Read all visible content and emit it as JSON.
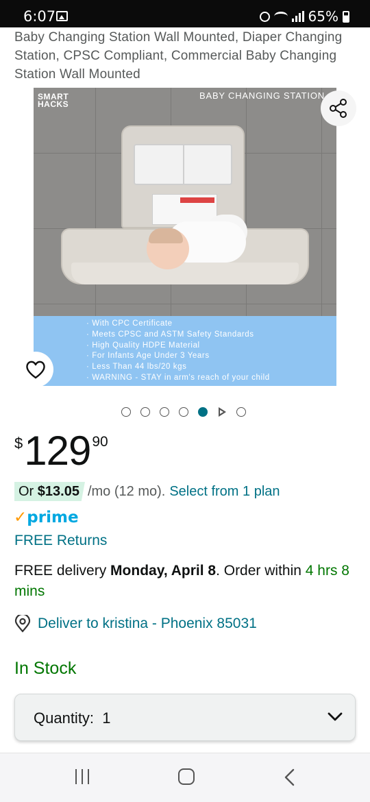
{
  "status_bar": {
    "time": "6:07",
    "battery": "65%",
    "icons": [
      "gallery-icon",
      "alarm-icon",
      "wifi-icon",
      "signal-icon",
      "battery-icon"
    ]
  },
  "product": {
    "title": "Baby Changing Station Wall Mounted, Diaper Changing Station, CPSC Compliant, Commercial Baby Changing Station Wall Mounted",
    "image": {
      "brand_logo": "SMART HACKS",
      "heading": "BABY CHANGING STATION",
      "features": [
        "With CPC Certificate",
        "Meets CPSC and ASTM Safety Standards",
        "High Quality HDPE Material",
        "For Infants Age Under 3 Years",
        "Less Than 44 lbs/20 kgs",
        "WARNING - STAY in arm's reach of your child"
      ],
      "panel_color": "#8fc4f2"
    },
    "gallery": {
      "total_items": 7,
      "active_index": 4,
      "video_index": 5
    }
  },
  "price": {
    "symbol": "$",
    "whole": "129",
    "fraction": "90"
  },
  "installment": {
    "prefix": "Or ",
    "amount": "$13.05",
    "term": "/mo (12 mo).",
    "link": "Select from 1 plan"
  },
  "prime": {
    "check": "✓",
    "label": "prime"
  },
  "returns": "FREE Returns",
  "delivery": {
    "prefix": "FREE delivery ",
    "date": "Monday, April 8",
    "middle": ". Order within ",
    "countdown": "4 hrs 8 mins"
  },
  "deliver_to": "Deliver to kristina - Phoenix 85031",
  "stock": "In Stock",
  "quantity": {
    "label": "Quantity:",
    "value": "1"
  },
  "colors": {
    "link": "#007185",
    "in_stock": "#007600",
    "prime": "#00a8e1",
    "accent": "#ff9900",
    "installment_badge": "#d5f2e3"
  }
}
